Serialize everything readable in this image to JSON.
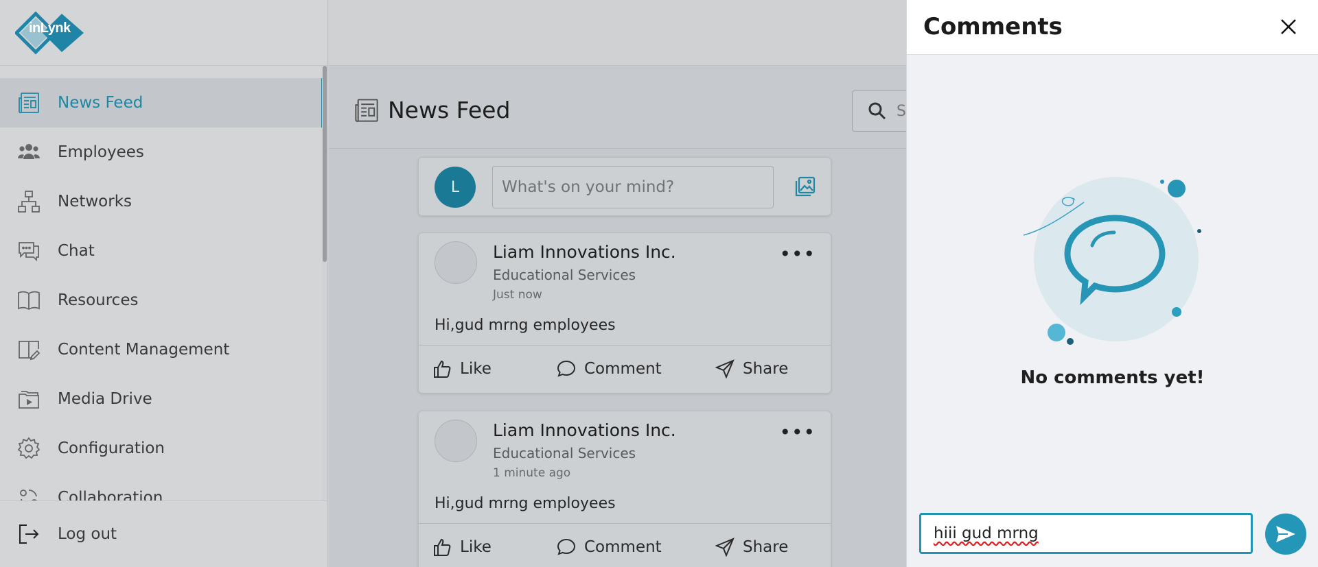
{
  "app": {
    "logo_text": "inLynk"
  },
  "sidebar": {
    "items": [
      {
        "label": "News Feed",
        "icon": "newspaper-icon",
        "active": true
      },
      {
        "label": "Employees",
        "icon": "employees-icon"
      },
      {
        "label": "Networks",
        "icon": "network-icon"
      },
      {
        "label": "Chat",
        "icon": "chat-icon"
      },
      {
        "label": "Resources",
        "icon": "book-icon"
      },
      {
        "label": "Content Management",
        "icon": "content-icon"
      },
      {
        "label": "Media Drive",
        "icon": "media-folder-icon"
      },
      {
        "label": "Configuration",
        "icon": "gear-icon"
      },
      {
        "label": "Collaboration",
        "icon": "collaboration-icon"
      }
    ],
    "logout_label": "Log out"
  },
  "main": {
    "page_title": "News Feed",
    "search_placeholder": "S",
    "composer": {
      "avatar_initial": "L",
      "placeholder": "What's on your mind?"
    },
    "posts": [
      {
        "author": "Liam Innovations Inc.",
        "org": "Educational Services",
        "time": "Just now",
        "text": "Hi,gud mrng employees",
        "actions": {
          "like": "Like",
          "comment": "Comment",
          "share": "Share"
        }
      },
      {
        "author": "Liam Innovations Inc.",
        "org": "Educational Services",
        "time": "1 minute ago",
        "text": "Hi,gud mrng employees",
        "actions": {
          "like": "Like",
          "comment": "Comment",
          "share": "Share"
        }
      }
    ]
  },
  "comments_panel": {
    "title": "Comments",
    "empty_text": "No comments yet!",
    "input_value": "hiii gud mrng"
  },
  "colors": {
    "accent": "#2497b8",
    "active_nav": "#1f87a3"
  }
}
